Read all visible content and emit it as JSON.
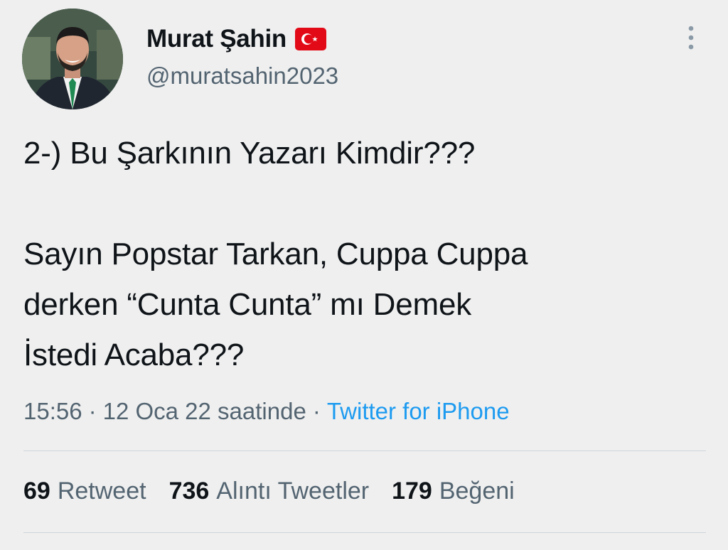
{
  "author": {
    "display_name": "Murat Şahin",
    "handle": "@muratsahin2023",
    "badge": "turkey-flag-icon"
  },
  "tweet": {
    "text": "2-) Bu Şarkının Yazarı Kimdir???\n\nSayın Popstar Tarkan, Cuppa Cuppa\nderken “Cunta Cunta” mı Demek\nİstedi Acaba???"
  },
  "meta": {
    "time": "15:56",
    "separator": "·",
    "date": "12 Oca 22 saatinde",
    "source": "Twitter for iPhone"
  },
  "stats": {
    "retweets": {
      "count": "69",
      "label": "Retweet"
    },
    "quotes": {
      "count": "736",
      "label": "Alıntı Tweetler"
    },
    "likes": {
      "count": "179",
      "label": "Beğeni"
    }
  },
  "colors": {
    "background": "#efefef",
    "text_primary": "#0f1419",
    "text_secondary": "#536471",
    "link": "#1d9bf0",
    "divider": "#cfd5da",
    "flag_red": "#e30a17"
  },
  "icons": {
    "more": "more-vertical-icon",
    "avatar": "profile-avatar"
  }
}
